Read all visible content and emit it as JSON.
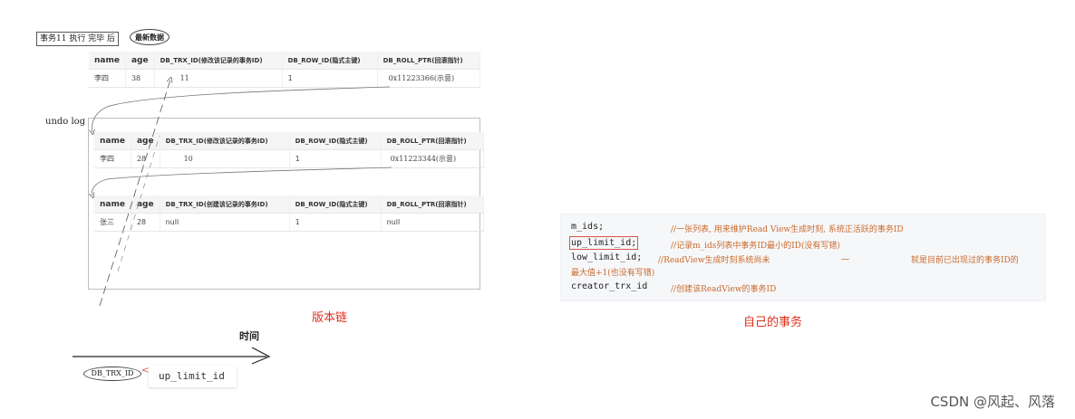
{
  "caption": {
    "text": "事务11 执行 完毕 后",
    "ellipse": "最新数据"
  },
  "top_table": {
    "headers": [
      "name",
      "age",
      "DB_TRX_ID(修改该记录的事务ID)",
      "DB_ROW_ID(隐式主键)",
      "DB_ROLL_PTR(回滚指针)"
    ],
    "row": [
      "李四",
      "38",
      "11",
      "1",
      "0x11223366(示意)"
    ]
  },
  "undo_label": "undo log",
  "undo_table1": {
    "headers": [
      "name",
      "age",
      "DB_TRX_ID(修改该记录的事务ID)",
      "DB_ROW_ID(隐式主键)",
      "DB_ROLL_PTR(回滚指针)"
    ],
    "row": [
      "李四",
      "28",
      "10",
      "1",
      "0x11223344(示意)"
    ]
  },
  "undo_table2": {
    "headers": [
      "name",
      "age",
      "DB_TRX_ID(创建该记录的事务ID)",
      "DB_ROW_ID(隐式主键)",
      "DB_ROLL_PTR(回滚指针)"
    ],
    "row": [
      "张三",
      "28",
      "null",
      "1",
      "null"
    ]
  },
  "version_chain_label": "版本链",
  "own_transaction_label": "自己的事务",
  "time_label": "时间",
  "axis_ellipse": "DB_TRX_ID",
  "axis_lt": "<",
  "axis_up_limit": "up_limit_id",
  "code": {
    "lines": [
      {
        "field": "m_ids;",
        "comment": "//一张列表, 用来维护Read View生成时刻, 系统正活跃的事务ID"
      },
      {
        "field": "up_limit_id;",
        "comment": "//记录m_ids列表中事务ID最小的ID(没有写错)"
      },
      {
        "field": "low_limit_id;",
        "comment": "//ReadView生成时刻系统尚未",
        "dash": "一",
        "comment_tail": "就是目前已出现过的事务ID的"
      },
      {
        "field": "",
        "comment": "最大值+1(也没有写错)"
      },
      {
        "field": "creator_trx_id",
        "comment": "//创建该ReadView的事务ID"
      }
    ]
  },
  "watermark": "CSDN @风起、风落"
}
